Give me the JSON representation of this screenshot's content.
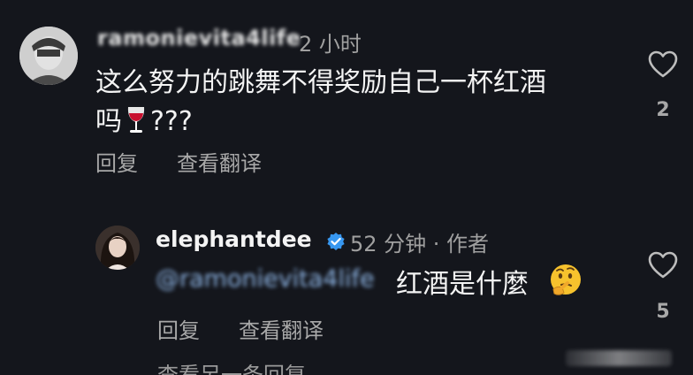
{
  "comment1": {
    "username": "ramonievita4life",
    "time": "2 小时",
    "text": "这么努力的跳舞不得奖励自己一杯红酒",
    "text_line2": "吗",
    "text_suffix": "???",
    "reply_label": "回复",
    "translate_label": "查看翻译",
    "likes": "2"
  },
  "comment2": {
    "username": "elephantdee",
    "meta": "52 分钟 · 作者",
    "mention": "@ramonievita4life",
    "text": "红酒是什麼",
    "reply_label": "回复",
    "translate_label": "查看翻译",
    "likes": "5"
  },
  "footer": {
    "text": "查看另一条回复"
  },
  "colors": {
    "background": "#14161c",
    "verified": "#3797f0",
    "mention": "#8fb6e6"
  }
}
